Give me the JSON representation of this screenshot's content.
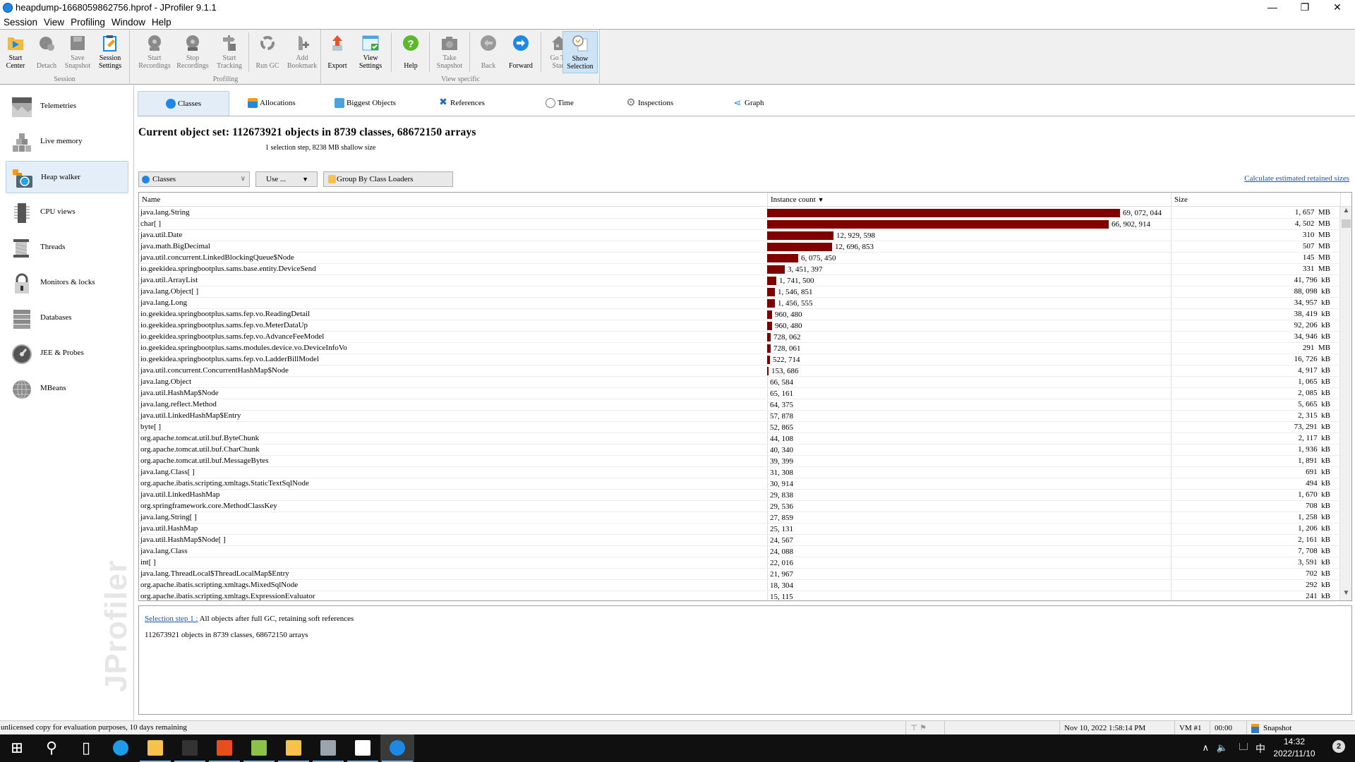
{
  "window": {
    "title": "heapdump-1668059862756.hprof - JProfiler 9.1.1",
    "minimize": "—",
    "restore": "❐",
    "close": "✕"
  },
  "menu": [
    "Session",
    "View",
    "Profiling",
    "Window",
    "Help"
  ],
  "toolbar": {
    "groups": [
      {
        "label": "Session",
        "buttons": [
          {
            "label1": "Start",
            "label2": "Center",
            "icon": "folder-play-icon",
            "enabled": true
          },
          {
            "label1": "Detach",
            "label2": "",
            "icon": "detach-plug-icon",
            "enabled": false
          },
          {
            "label1": "Save",
            "label2": "Snapshot",
            "icon": "floppy-disk-icon",
            "enabled": false
          },
          {
            "label1": "Session",
            "label2": "Settings",
            "icon": "clipboard-edit-icon",
            "enabled": true
          }
        ]
      },
      {
        "label": "Profiling",
        "buttons": [
          {
            "label1": "Start",
            "label2": "Recordings",
            "icon": "film-reel-start-icon",
            "enabled": false
          },
          {
            "label1": "Stop",
            "label2": "Recordings",
            "icon": "film-reel-stop-icon",
            "enabled": false
          },
          {
            "label1": "Start",
            "label2": "Tracking",
            "icon": "signpost-icon",
            "enabled": false
          },
          {
            "label1": "Run GC",
            "label2": "",
            "icon": "recycle-icon",
            "enabled": false
          },
          {
            "label1": "Add",
            "label2": "Bookmark",
            "icon": "bookmark-add-icon",
            "enabled": false
          }
        ]
      },
      {
        "label": "View specific",
        "buttons": [
          {
            "label1": "Export",
            "label2": "",
            "icon": "export-arrow-icon",
            "enabled": true
          },
          {
            "label1": "View",
            "label2": "Settings",
            "icon": "view-settings-icon",
            "enabled": true
          },
          {
            "label1": "Help",
            "label2": "",
            "icon": "help-icon",
            "enabled": true
          },
          {
            "label1": "Take",
            "label2": "Snapshot",
            "icon": "camera-icon",
            "enabled": false
          },
          {
            "label1": "Back",
            "label2": "",
            "icon": "back-arrow-icon",
            "enabled": false
          },
          {
            "label1": "Forward",
            "label2": "",
            "icon": "forward-arrow-icon",
            "enabled": true
          },
          {
            "label1": "Go To",
            "label2": "Start",
            "icon": "home-icon",
            "enabled": false
          },
          {
            "label1": "Show",
            "label2": "Selection",
            "icon": "clock-document-icon",
            "enabled": true,
            "active": true
          }
        ]
      }
    ]
  },
  "sidebar": {
    "items": [
      {
        "label": "Telemetries",
        "icon": "telemetries-icon"
      },
      {
        "label": "Live memory",
        "icon": "live-memory-icon"
      },
      {
        "label": "Heap walker",
        "icon": "heap-walker-icon",
        "active": true
      },
      {
        "label": "CPU views",
        "icon": "cpu-chip-icon"
      },
      {
        "label": "Threads",
        "icon": "thread-spool-icon"
      },
      {
        "label": "Monitors & locks",
        "icon": "padlock-icon"
      },
      {
        "label": "Databases",
        "icon": "database-icon"
      },
      {
        "label": "JEE & Probes",
        "icon": "gauge-icon"
      },
      {
        "label": "MBeans",
        "icon": "globe-icon"
      }
    ],
    "watermark": "JProfiler"
  },
  "tabs": [
    {
      "label": "Classes",
      "icon": "classes-icon",
      "active": true
    },
    {
      "label": "Allocations",
      "icon": "allocations-icon"
    },
    {
      "label": "Biggest Objects",
      "icon": "biggest-objects-icon"
    },
    {
      "label": "References",
      "icon": "references-icon"
    },
    {
      "label": "Time",
      "icon": "time-clock-icon"
    },
    {
      "label": "Inspections",
      "icon": "inspections-gear-icon"
    },
    {
      "label": "Graph",
      "icon": "graph-icon"
    }
  ],
  "object_set": {
    "heading": "Current object set: 112673921 objects in 8739 classes, 68672150 arrays",
    "subline": "1 selection step, 8238 MB shallow size"
  },
  "controls": {
    "view_select": "Classes",
    "use_button": "Use ...",
    "group_button": "Group By Class Loaders",
    "retained_link": "Calculate estimated retained sizes"
  },
  "table": {
    "columns": {
      "name": "Name",
      "count": "Instance count",
      "size": "Size"
    },
    "sort_indicator": "▼",
    "max_count": 69072044,
    "bar_color": "#800000",
    "rows": [
      {
        "name": "java.lang.String",
        "count": 69072044,
        "count_text": "69, 072, 044",
        "size": "1, 657  MB"
      },
      {
        "name": "char[ ]",
        "count": 66902914,
        "count_text": "66, 902, 914",
        "size": "4, 502  MB"
      },
      {
        "name": "java.util.Date",
        "count": 12929598,
        "count_text": "12, 929, 598",
        "size": "310  MB"
      },
      {
        "name": "java.math.BigDecimal",
        "count": 12696853,
        "count_text": "12, 696, 853",
        "size": "507  MB"
      },
      {
        "name": "java.util.concurrent.LinkedBlockingQueue$Node",
        "count": 6075450,
        "count_text": "6, 075, 450",
        "size": "145  MB"
      },
      {
        "name": "io.geekidea.springbootplus.sams.base.entity.DeviceSend",
        "count": 3451397,
        "count_text": "3, 451, 397",
        "size": "331  MB"
      },
      {
        "name": "java.util.ArrayList",
        "count": 1741500,
        "count_text": "1, 741, 500",
        "size": "41, 796  kB"
      },
      {
        "name": "java.lang.Object[ ]",
        "count": 1546851,
        "count_text": "1, 546, 851",
        "size": "88, 098  kB"
      },
      {
        "name": "java.lang.Long",
        "count": 1456555,
        "count_text": "1, 456, 555",
        "size": "34, 957  kB"
      },
      {
        "name": "io.geekidea.springbootplus.sams.fep.vo.ReadingDetail",
        "count": 960480,
        "count_text": "960, 480",
        "size": "38, 419  kB"
      },
      {
        "name": "io.geekidea.springbootplus.sams.fep.vo.MeterDataUp",
        "count": 960480,
        "count_text": "960, 480",
        "size": "92, 206  kB"
      },
      {
        "name": "io.geekidea.springbootplus.sams.fep.vo.AdvanceFeeModel",
        "count": 728062,
        "count_text": "728, 062",
        "size": "34, 946  kB"
      },
      {
        "name": "io.geekidea.springbootplus.sams.modules.device.vo.DeviceInfoVo",
        "count": 728061,
        "count_text": "728, 061",
        "size": "291  MB"
      },
      {
        "name": "io.geekidea.springbootplus.sams.fep.vo.LadderBillModel",
        "count": 522714,
        "count_text": "522, 714",
        "size": "16, 726  kB"
      },
      {
        "name": "java.util.concurrent.ConcurrentHashMap$Node",
        "count": 153686,
        "count_text": "153, 686",
        "size": "4, 917  kB"
      },
      {
        "name": "java.lang.Object",
        "count": 66584,
        "count_text": "66, 584",
        "size": "1, 065  kB"
      },
      {
        "name": "java.util.HashMap$Node",
        "count": 65161,
        "count_text": "65, 161",
        "size": "2, 085  kB"
      },
      {
        "name": "java.lang.reflect.Method",
        "count": 64375,
        "count_text": "64, 375",
        "size": "5, 665  kB"
      },
      {
        "name": "java.util.LinkedHashMap$Entry",
        "count": 57878,
        "count_text": "57, 878",
        "size": "2, 315  kB"
      },
      {
        "name": "byte[ ]",
        "count": 52865,
        "count_text": "52, 865",
        "size": "73, 291  kB"
      },
      {
        "name": "org.apache.tomcat.util.buf.ByteChunk",
        "count": 44108,
        "count_text": "44, 108",
        "size": "2, 117  kB"
      },
      {
        "name": "org.apache.tomcat.util.buf.CharChunk",
        "count": 40340,
        "count_text": "40, 340",
        "size": "1, 936  kB"
      },
      {
        "name": "org.apache.tomcat.util.buf.MessageBytes",
        "count": 39399,
        "count_text": "39, 399",
        "size": "1, 891  kB"
      },
      {
        "name": "java.lang.Class[ ]",
        "count": 31308,
        "count_text": "31, 308",
        "size": "691  kB"
      },
      {
        "name": "org.apache.ibatis.scripting.xmltags.StaticTextSqlNode",
        "count": 30914,
        "count_text": "30, 914",
        "size": "494  kB"
      },
      {
        "name": "java.util.LinkedHashMap",
        "count": 29838,
        "count_text": "29, 838",
        "size": "1, 670  kB"
      },
      {
        "name": "org.springframework.core.MethodClassKey",
        "count": 29536,
        "count_text": "29, 536",
        "size": "708  kB"
      },
      {
        "name": "java.lang.String[ ]",
        "count": 27859,
        "count_text": "27, 859",
        "size": "1, 258  kB"
      },
      {
        "name": "java.util.HashMap",
        "count": 25131,
        "count_text": "25, 131",
        "size": "1, 206  kB"
      },
      {
        "name": "java.util.HashMap$Node[ ]",
        "count": 24567,
        "count_text": "24, 567",
        "size": "2, 161  kB"
      },
      {
        "name": "java.lang.Class",
        "count": 24088,
        "count_text": "24, 088",
        "size": "7, 708  kB"
      },
      {
        "name": "int[ ]",
        "count": 22016,
        "count_text": "22, 016",
        "size": "3, 591  kB"
      },
      {
        "name": "java.lang.ThreadLocal$ThreadLocalMap$Entry",
        "count": 21967,
        "count_text": "21, 967",
        "size": "702  kB"
      },
      {
        "name": "org.apache.ibatis.scripting.xmltags.MixedSqlNode",
        "count": 18304,
        "count_text": "18, 304",
        "size": "292  kB"
      },
      {
        "name": "org.apache.ibatis.scripting.xmltags.ExpressionEvaluator",
        "count": 15115,
        "count_text": "15, 115",
        "size": "241  kB"
      }
    ]
  },
  "selection_panel": {
    "step_link": "Selection step 1 :",
    "step_desc": " All objects after full GC, retaining soft references",
    "summary": "112673921 objects in 8739 classes, 68672150 arrays"
  },
  "statusbar": {
    "message": "unlicensed copy for evaluation purposes, 10 days remaining",
    "datetime": "Nov 10, 2022 1:58:14 PM",
    "vm": "VM #1",
    "elapsed": "00:00",
    "mode": "Snapshot"
  },
  "taskbar": {
    "apps": [
      {
        "icon": "windows-start-icon"
      },
      {
        "icon": "search-icon"
      },
      {
        "icon": "task-view-icon"
      },
      {
        "icon": "internet-explorer-icon"
      },
      {
        "icon": "file-explorer-icon",
        "open": true
      },
      {
        "icon": "command-prompt-icon",
        "open": true
      },
      {
        "icon": "netbeans-profiler-icon",
        "open": true
      },
      {
        "icon": "notepad-plus-icon",
        "open": true
      },
      {
        "icon": "python-idle-icon",
        "open": true
      },
      {
        "icon": "performance-monitor-icon",
        "open": true
      },
      {
        "icon": "blank-document-icon",
        "open": true
      },
      {
        "icon": "jprofiler-icon",
        "open": true,
        "active": true
      }
    ],
    "time": "14:32",
    "date": "2022/11/10",
    "ime": "中",
    "notifications": "2"
  }
}
